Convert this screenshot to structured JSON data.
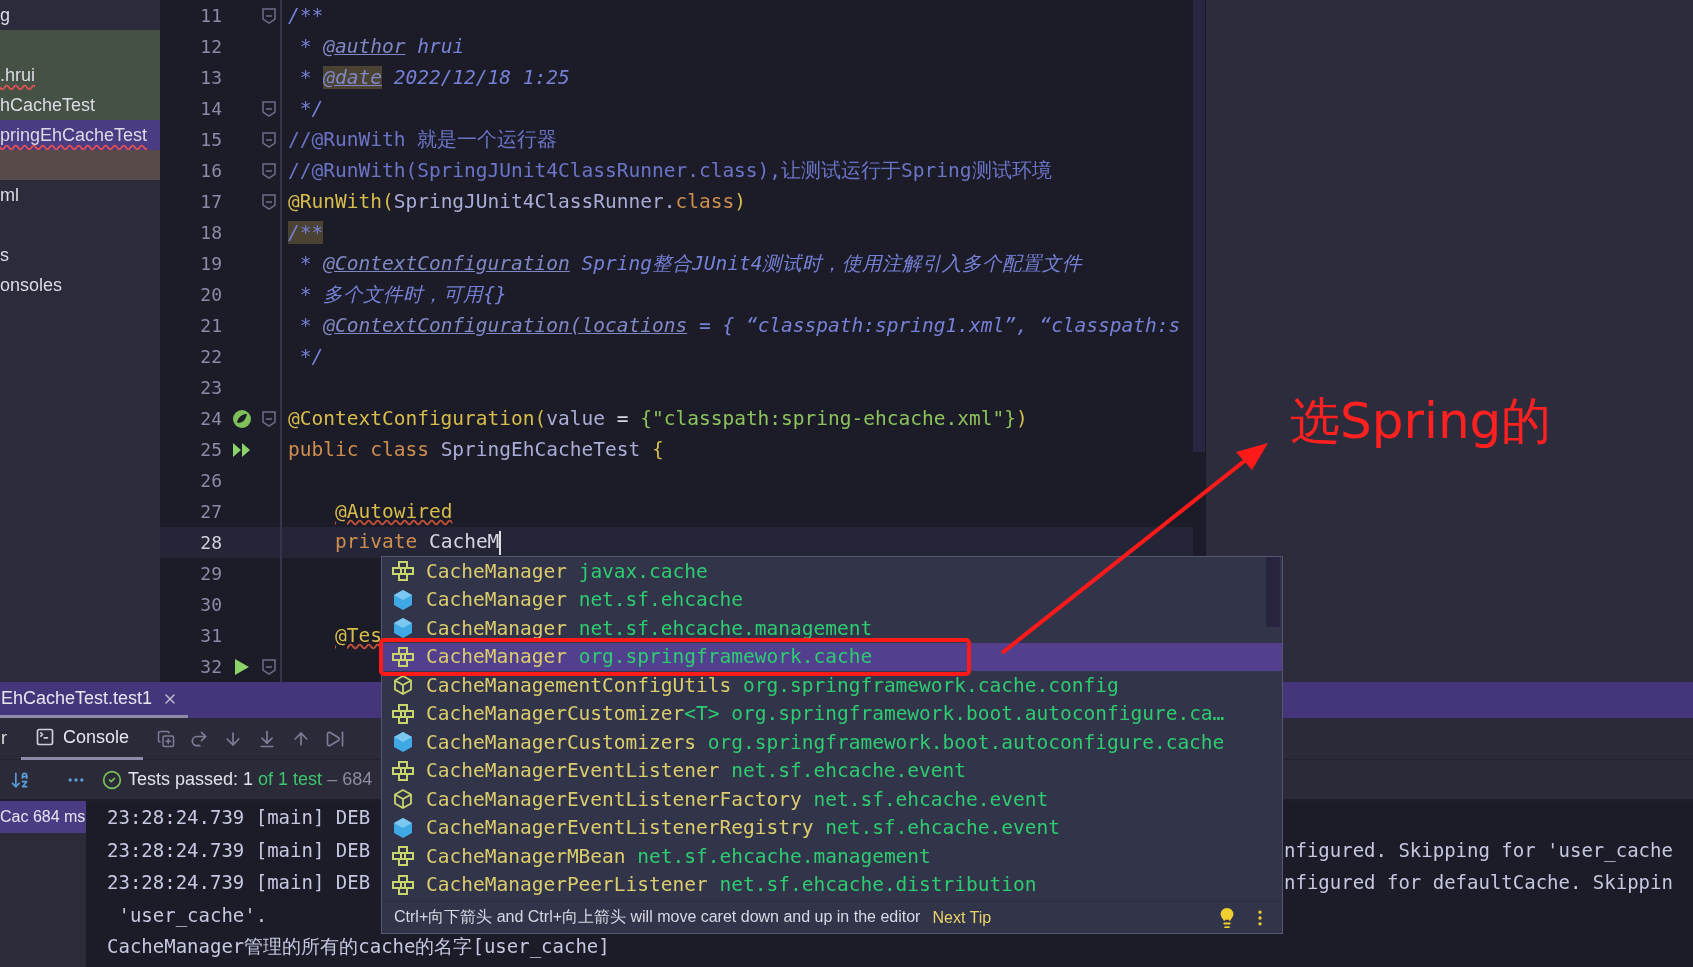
{
  "project_tree": [
    {
      "label": "g",
      "selected": false,
      "error": false,
      "kind": "plain"
    },
    {
      "selected": false,
      "kind": "scope"
    },
    {
      "label": ".hrui",
      "selected": false,
      "error": true,
      "kind": "scope"
    },
    {
      "label": "hCacheTest",
      "selected": false,
      "error": false,
      "kind": "scope"
    },
    {
      "label": "pringEhCacheTest",
      "selected": true,
      "error": true,
      "kind": "scope"
    },
    {
      "selected": false,
      "kind": "warning"
    },
    {
      "label": "ml",
      "selected": false,
      "error": false,
      "kind": "plain"
    },
    {
      "selected": false,
      "kind": "blank"
    },
    {
      "label": "s",
      "selected": false,
      "error": false,
      "kind": "plain"
    },
    {
      "label": "onsoles",
      "selected": false,
      "error": false,
      "kind": "plain"
    }
  ],
  "editor": {
    "lines": [
      {
        "number": "11",
        "fold": true,
        "current": false,
        "tokens": [
          {
            "kind": "doc",
            "t": "/**"
          }
        ]
      },
      {
        "number": "12",
        "fold": false,
        "current": false,
        "tokens": [
          {
            "kind": "doc",
            "t": " * "
          },
          {
            "kind": "doctag",
            "t": "@author"
          },
          {
            "kind": "doc",
            "t": " hrui"
          }
        ]
      },
      {
        "number": "13",
        "fold": false,
        "current": false,
        "tokens": [
          {
            "kind": "doc",
            "t": " * "
          },
          {
            "kind": "doctag-marked",
            "t": "@date"
          },
          {
            "kind": "doc",
            "t": " 2022/12/18 1:25"
          }
        ]
      },
      {
        "number": "14",
        "fold": true,
        "current": false,
        "tokens": [
          {
            "kind": "doc",
            "t": " */"
          }
        ]
      },
      {
        "number": "15",
        "fold": true,
        "current": false,
        "tokens": [
          {
            "kind": "comment",
            "t": "//@RunWith 就是一个运行器"
          }
        ]
      },
      {
        "number": "16",
        "fold": true,
        "current": false,
        "tokens": [
          {
            "kind": "comment",
            "t": "//@RunWith(SpringJUnit4ClassRunner.class),让测试运行于Spring测试环境"
          }
        ]
      },
      {
        "number": "17",
        "fold": true,
        "current": false,
        "tokens": [
          {
            "kind": "annotation",
            "t": "@RunWith("
          },
          {
            "kind": "type",
            "t": "SpringJUnit4ClassRunner."
          },
          {
            "kind": "keyword",
            "t": "class"
          },
          {
            "kind": "annotation",
            "t": ")"
          }
        ]
      },
      {
        "number": "18",
        "fold": false,
        "current": false,
        "tokens": [
          {
            "kind": "doc-marked",
            "t": "/**"
          }
        ]
      },
      {
        "number": "19",
        "fold": false,
        "current": false,
        "tokens": [
          {
            "kind": "doc",
            "t": " * "
          },
          {
            "kind": "doctag",
            "t": "@ContextConfiguration"
          },
          {
            "kind": "doc",
            "t": " Spring整合JUnit4测试时，使用注解引入多个配置文件"
          }
        ]
      },
      {
        "number": "20",
        "fold": false,
        "current": false,
        "tokens": [
          {
            "kind": "doc",
            "t": " * 多个文件时，可用{}"
          }
        ]
      },
      {
        "number": "21",
        "fold": false,
        "current": false,
        "tokens": [
          {
            "kind": "doc",
            "t": " * "
          },
          {
            "kind": "doctag",
            "t": "@ContextConfiguration(locations"
          },
          {
            "kind": "doc",
            "t": " = { “classpath:spring1.xml”, “classpath:s"
          }
        ]
      },
      {
        "number": "22",
        "fold": false,
        "current": false,
        "tokens": [
          {
            "kind": "doc",
            "t": " */"
          }
        ]
      },
      {
        "number": "23",
        "fold": false,
        "current": false
      },
      {
        "number": "24",
        "fold": true,
        "current": false,
        "kind": "spring",
        "tokens": [
          {
            "kind": "annotation",
            "t": "@ContextConfiguration("
          },
          {
            "kind": "type",
            "t": "value"
          },
          {
            "kind": "plain",
            "t": " = "
          },
          {
            "kind": "string",
            "t": "{\"classpath:spring-ehcache.xml\"}"
          },
          {
            "kind": "annotation",
            "t": ")"
          }
        ]
      },
      {
        "number": "25",
        "fold": false,
        "current": false,
        "kind": "run-all",
        "tokens": [
          {
            "kind": "keyword",
            "t": "public class "
          },
          {
            "kind": "type",
            "t": "SpringEhCacheTest "
          },
          {
            "kind": "annotation",
            "t": "{"
          }
        ]
      },
      {
        "number": "26",
        "fold": false,
        "current": false
      },
      {
        "number": "27",
        "fold": false,
        "current": false,
        "indented": true,
        "tokens": [
          {
            "kind": "annotation-warn",
            "t": "@Autowired"
          }
        ]
      },
      {
        "number": "28",
        "fold": false,
        "current": true,
        "indented": true,
        "tokens": [
          {
            "kind": "keyword",
            "t": "private "
          },
          {
            "kind": "plain",
            "t": "CacheM"
          }
        ]
      },
      {
        "number": "29",
        "fold": false,
        "current": false
      },
      {
        "number": "30",
        "fold": false,
        "current": false
      },
      {
        "number": "31",
        "fold": false,
        "current": false,
        "indented": true,
        "tokens": [
          {
            "kind": "annotation-warn",
            "t": "@Tes"
          }
        ]
      },
      {
        "number": "32",
        "fold": true,
        "current": false,
        "kind": "run"
      }
    ]
  },
  "completion": {
    "items": [
      {
        "kind": "interface",
        "name": "CacheManager",
        "package": "javax.cache",
        "selected": false
      },
      {
        "kind": "class",
        "name": "CacheManager",
        "package": "net.sf.ehcache",
        "selected": false
      },
      {
        "kind": "class",
        "name": "CacheManager",
        "package": "net.sf.ehcache.management",
        "selected": false
      },
      {
        "kind": "interface",
        "name": "CacheManager",
        "package": "org.springframework.cache",
        "selected": true
      },
      {
        "kind": "abstract",
        "name": "CacheManagementConfigUtils",
        "package": "org.springframework.cache.config",
        "selected": false
      },
      {
        "kind": "interface",
        "name": "CacheManagerCustomizer",
        "generic": "<T>",
        "package": "org.springframework.boot.autoconfigure.ca…",
        "selected": false
      },
      {
        "kind": "class",
        "name": "CacheManagerCustomizers",
        "package": "org.springframework.boot.autoconfigure.cache",
        "selected": false
      },
      {
        "kind": "interface",
        "name": "CacheManagerEventListener",
        "package": "net.sf.ehcache.event",
        "selected": false
      },
      {
        "kind": "abstract",
        "name": "CacheManagerEventListenerFactory",
        "package": "net.sf.ehcache.event",
        "selected": false
      },
      {
        "kind": "class",
        "name": "CacheManagerEventListenerRegistry",
        "package": "net.sf.ehcache.event",
        "selected": false
      },
      {
        "kind": "interface",
        "name": "CacheManagerMBean",
        "package": "net.sf.ehcache.management",
        "selected": false
      },
      {
        "kind": "interface",
        "name": "CacheManagerPeerListener",
        "package": "net.sf.ehcache.distribution",
        "selected": false
      }
    ],
    "tip": "Ctrl+向下箭头 and Ctrl+向上箭头 will move caret down and up in the editor",
    "next_tip": "Next Tip"
  },
  "run_panel": {
    "tab": "EhCacheTest.test1",
    "toolbar_fragment": "r",
    "console_tab": {
      "label": "Console",
      "selected": true
    },
    "tests_status": {
      "label": "Tests passed: 1 ",
      "count": "of 1 test",
      "time": " – 684"
    },
    "tree": [
      {
        "label": "Cac 684 ms",
        "selected": true
      }
    ],
    "log": [
      {
        "left": "23:28:24.739 [main] DEB"
      },
      {
        "left": "23:28:24.739 [main] DEB",
        "right": "nfigured. Skipping for 'user_cache"
      },
      {
        "left": "23:28:24.739 [main] DEB",
        "right": "nfigured for defaultCache. Skippin"
      },
      {
        "left": " 'user_cache'."
      },
      {
        "left": "CacheManager管理的所有的cache的名字[user_cache]"
      }
    ]
  },
  "annotation": {
    "text": "选Spring的"
  }
}
